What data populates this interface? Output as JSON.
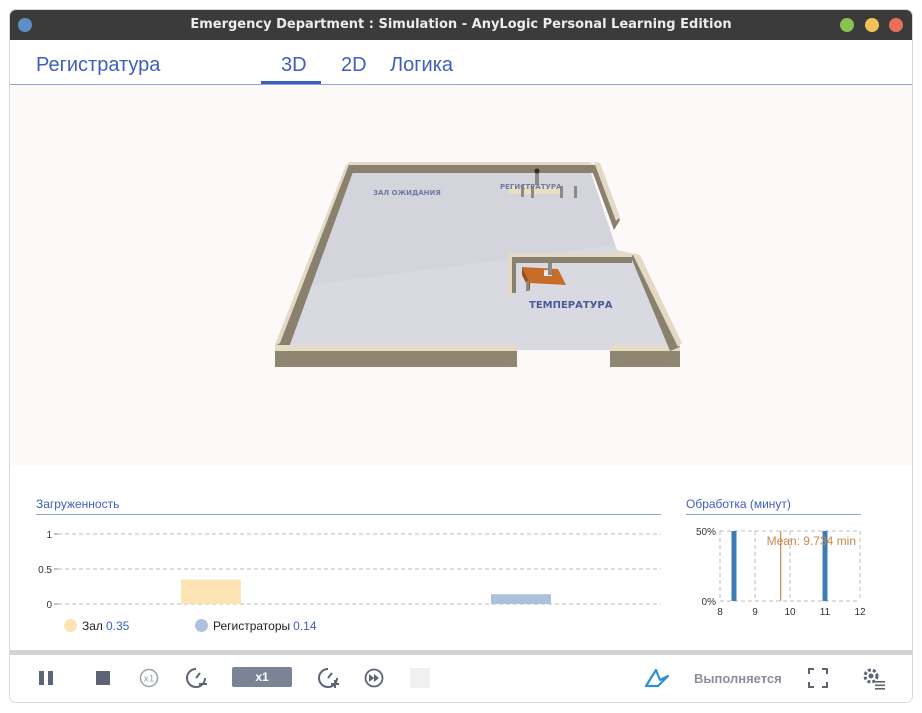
{
  "window": {
    "title": "Emergency Department : Simulation - AnyLogic Personal Learning Edition",
    "controls": [
      "close-dot-icon",
      "minimize-dot-icon",
      "maximize-dot-icon"
    ],
    "colors": {
      "titlebar": "#3b3b3b",
      "left_dot": "#5d8fc4",
      "green_dot": "#8cc152",
      "yellow_dot": "#f3c35a",
      "red_dot": "#ed6d5a"
    }
  },
  "nav": {
    "section_label": "Регистратура",
    "tabs": [
      {
        "label": "3D",
        "active": true
      },
      {
        "label": "2D",
        "active": false
      },
      {
        "label": "Логика",
        "active": false
      }
    ],
    "accent": "#3e5fc0"
  },
  "scene": {
    "room_labels": [
      "ЗАЛ ОЖИДАНИЯ",
      "РЕГИСТРАТУРА",
      "ТЕМПЕРАТУРА"
    ]
  },
  "utilization": {
    "title": "Загруженность",
    "y_ticks": [
      "1",
      "0.5",
      "0"
    ],
    "legend": [
      {
        "label": "Зал",
        "value": "0.35",
        "color": "#fde4b4"
      },
      {
        "label": "Регистраторы",
        "value": "0.14",
        "color": "#aec1dc"
      }
    ]
  },
  "processing": {
    "title": "Обработка (минут)",
    "y_ticks": [
      "50%",
      "0%"
    ],
    "x_ticks": [
      "8",
      "9",
      "10",
      "11",
      "12"
    ],
    "mean_label": "Mean: 9.734 min",
    "mean_color": "#c98a4b"
  },
  "chart_data": [
    {
      "type": "bar",
      "title": "Загруженность",
      "categories": [
        "Зал",
        "Регистраторы"
      ],
      "values": [
        0.35,
        0.14
      ],
      "ylim": [
        0,
        1
      ],
      "colors": [
        "#fde4b4",
        "#aec1dc"
      ],
      "grid": true
    },
    {
      "type": "bar",
      "title": "Обработка (минут)",
      "xlim": [
        8,
        12
      ],
      "ylim": [
        0,
        0.5
      ],
      "x": [
        8.4,
        11
      ],
      "values": [
        0.5,
        0.5
      ],
      "mean": 9.734,
      "grid": true
    }
  ],
  "toolbar": {
    "speed_label": "x1",
    "status_label": "Выполняется",
    "buttons": [
      "pause-icon",
      "stop-icon",
      "step-icon",
      "slow-down-icon",
      "speed-up-icon",
      "run-fast-icon",
      "blank-button"
    ],
    "right_icons": [
      "anylogic-logo-icon",
      "fullscreen-icon",
      "settings-icon"
    ]
  }
}
